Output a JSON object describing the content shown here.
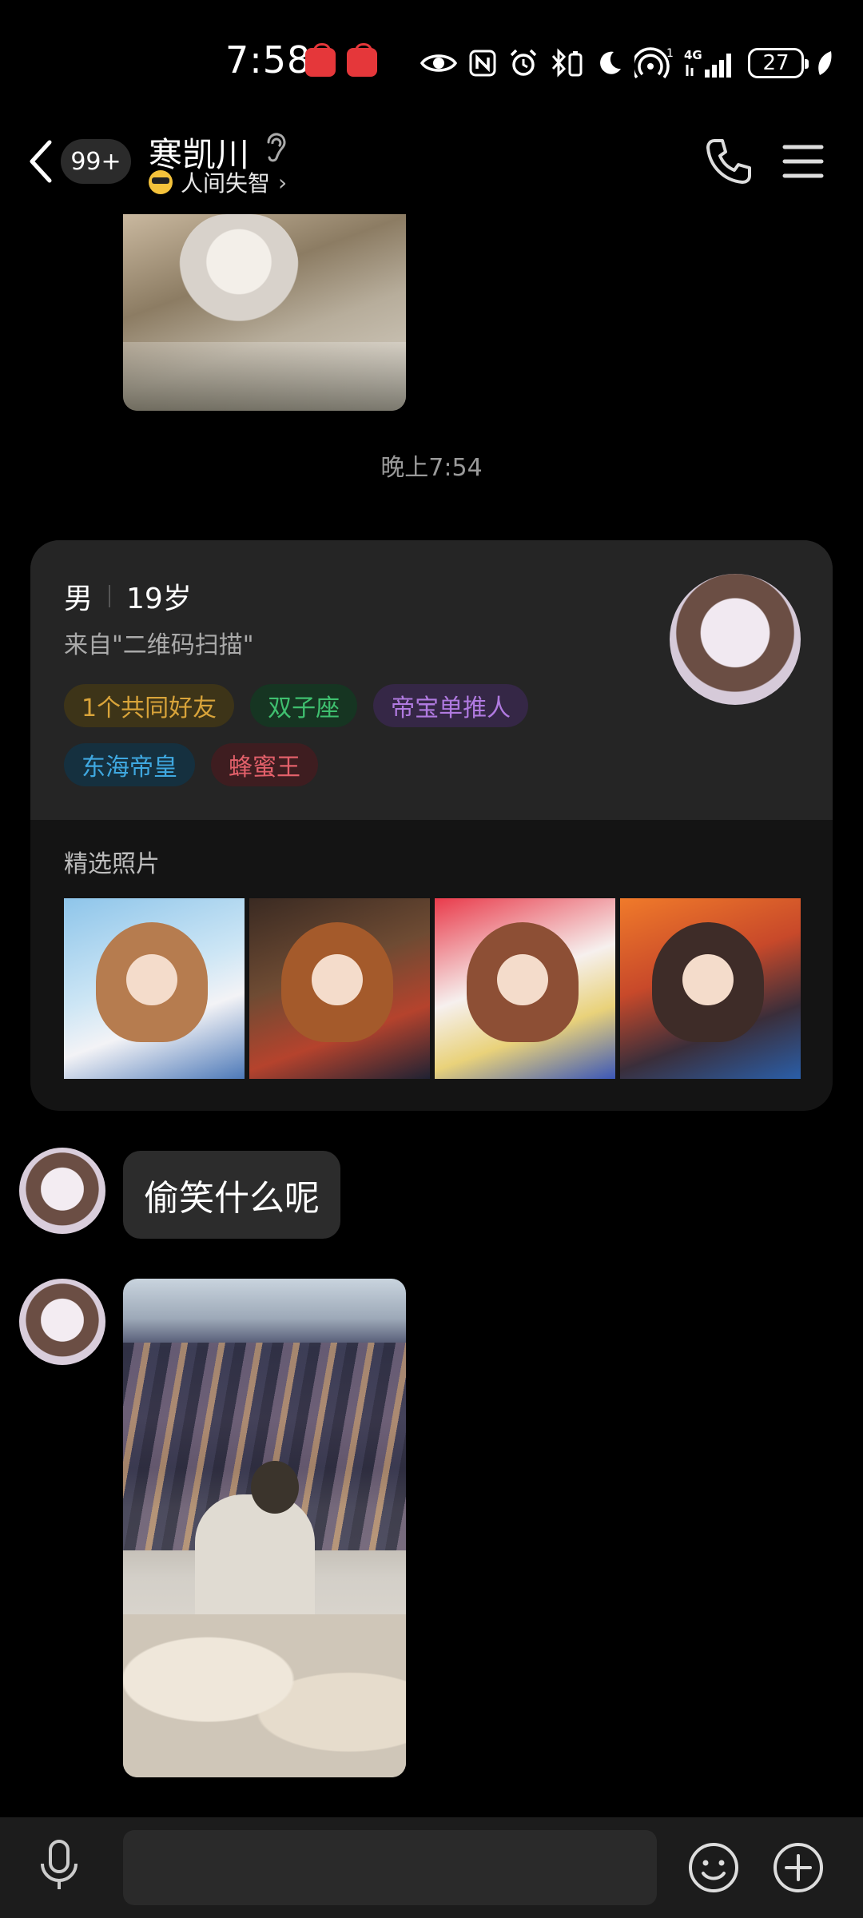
{
  "status_bar": {
    "time": "7:58",
    "battery": "27",
    "network": "4G",
    "notification_apps": [
      "huawei-app",
      "huawei-app"
    ]
  },
  "header": {
    "unread_count": "99+",
    "contact_name": "寒凯川",
    "status_text": "人间失智",
    "status_chevron": "›"
  },
  "messages": {
    "timestamp": "晚上7:54",
    "text_bubble": "偷笑什么呢"
  },
  "profile_card": {
    "gender": "男",
    "age": "19岁",
    "source": "来自\"二维码扫描\"",
    "tags": [
      {
        "label": "1个共同好友",
        "color": "#d9a43a",
        "bg": "#3d3418"
      },
      {
        "label": "双子座",
        "color": "#3fbf6f",
        "bg": "#163522"
      },
      {
        "label": "帝宝单推人",
        "color": "#b07ae0",
        "bg": "#352746"
      },
      {
        "label": "东海帝皇",
        "color": "#3fa8e0",
        "bg": "#15303f"
      },
      {
        "label": "蜂蜜王",
        "color": "#e2606a",
        "bg": "#3e1d20"
      }
    ],
    "section_label": "精选照片",
    "photos": [
      {
        "bg": "linear-gradient(160deg,#8ec5ea 0%,#cde6f5 45%,#f3f3f6 65%,#4d79b8 100%)",
        "hair": "#b67c4f"
      },
      {
        "bg": "linear-gradient(160deg,#3a2a22 0%,#6e4b33 40%,#b5432d 70%,#1f2233 100%)",
        "hair": "#a45a2b"
      },
      {
        "bg": "linear-gradient(160deg,#e93b4b 0%,#f6f0ee 45%,#e9d27a 70%,#3b57b8 100%)",
        "hair": "#8d4f35"
      },
      {
        "bg": "linear-gradient(160deg,#f07a2a 0%,#c8492a 40%,#3a2e3a 70%,#2a5ea8 100%)",
        "hair": "#3e2c28"
      }
    ]
  },
  "input_bar": {
    "placeholder": ""
  }
}
